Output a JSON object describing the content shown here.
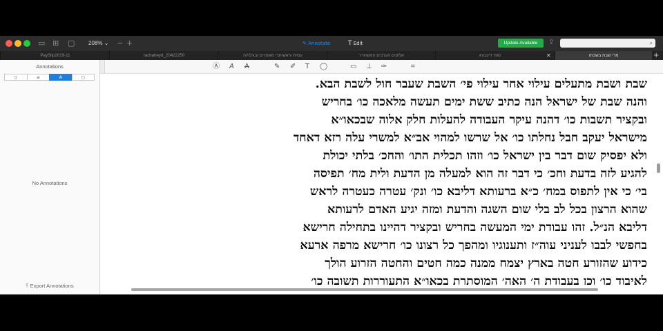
{
  "app": {
    "zoom": "208%",
    "modes": {
      "annotate": "Annotate",
      "edit": "Edit"
    },
    "update_button": "Update Available",
    "colors": {
      "accent": "#1e7fe0",
      "update": "#27a84a",
      "annotate_mode": "#1f8fff"
    },
    "icons": [
      "close-icon",
      "minimize-icon",
      "maximize-icon",
      "sidebar-icon",
      "grid-icon",
      "zoom-out-icon",
      "zoom-in-icon",
      "text-tool-icon",
      "share-icon",
      "search-icon"
    ]
  },
  "tabs": [
    {
      "label": "PaySlip2019-11"
    },
    {
      "label": "rachaheyd_20422250"
    },
    {
      "label": "עמית וראשיתךי מאמרים ובגילוי/ה"
    },
    {
      "label": "אלוקים הערבים המשחרר"
    },
    {
      "label": "ספר דינבורג"
    },
    {
      "label": "מדי שבת בשבתו"
    }
  ],
  "sidebar": {
    "title": "Annotations",
    "empty_text": "No Annotations",
    "export_label": "Export Annotations"
  },
  "document": {
    "lines": [
      "שבת ושבת מתעלים עילוי אחר עילוי פי׳ השבת שעבר חול לשבת הבא.",
      "והנה שבת של ישראל הנה כתיב ששת ימים תעשה מלאכה כו׳ בחריש",
      "ובקציר תשבות כו׳ דהנה עיקר העבודה להעלות חלק אלוה שבכאו״א",
      "מישראל יעקב חבל נחלתו כו׳ אל שרשו למהוי אב״א למשרי עלה רזא דאחד",
      "ולא יפסיק שום דבר בין ישראל כו׳ וזהו תכלית התו׳ והחכ׳ בלתי יכולת",
      "להגיע לזה בדעת וחכ׳ כי דבר זה הוא למעלה מן הדעת ולית מח׳ תפיסה",
      "בי׳ כי אין לתפוס במח׳ כ״א ברעותא דליבא כו׳ ונק׳ עטרה כעטרה לראש",
      "שהוא הרצון בכל לב בלי שום השגה והדעת ומזה יגיע האדם לרעותא",
      "דליבא הנ״ל. זהו עבודת ימי המעשה בחריש ובקציר דהיינו בתחילה חרישא",
      "בחפשי לבבו לעניני עוה״ז ותענוגיו ומהפך כל רצונו כו׳ חרישא מרפה ארעא",
      "כידוע שהזורע חטה בארץ יצמח ממנה כמה חטים והחטה הזרוע הולך",
      "לאיבוד כו׳ וכן בעבודת ה׳ האה׳ המוסתרת בכאו״א התעוררות תשובה כו׳"
    ]
  }
}
